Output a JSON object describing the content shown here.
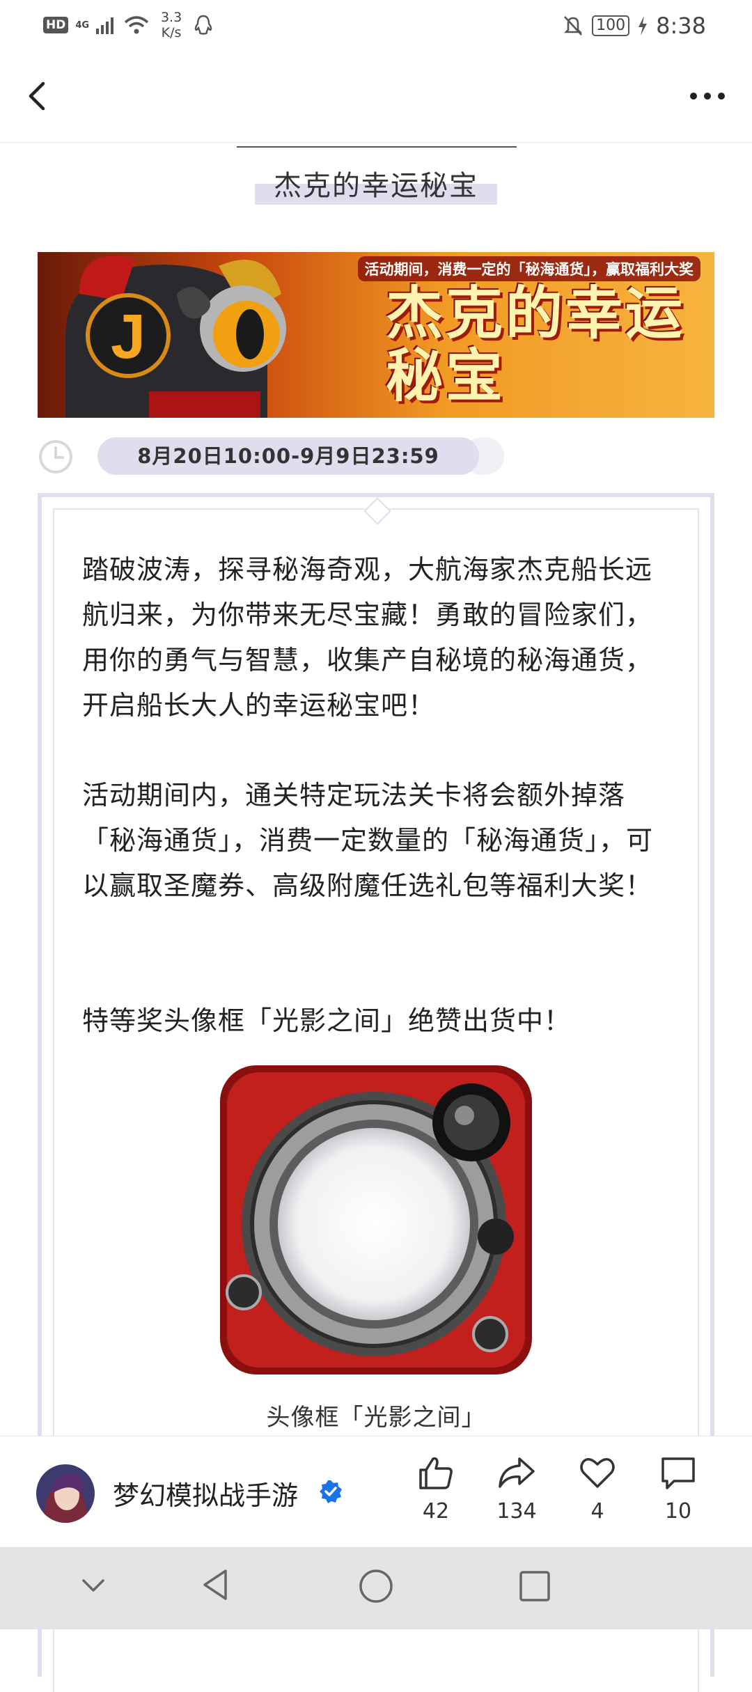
{
  "status_bar": {
    "hd": "HD",
    "network": "4G",
    "speed_value": "3.3",
    "speed_unit": "K/s",
    "battery": "100",
    "time": "8:38"
  },
  "article": {
    "title": "杰克的幸运秘宝",
    "banner": {
      "tagline": "活动期间，消费一定的「秘海通货」，赢取福利大奖",
      "title": "杰克的幸运秘宝"
    },
    "date_range": "8月20日10:00-9月9日23:59",
    "paragraphs": [
      "踏破波涛，探寻秘海奇观，大航海家杰克船长远航归来，为你带来无尽宝藏！勇敢的冒险家们，用你的勇气与智慧，收集产自秘境的秘海通货，开启船长大人的幸运秘宝吧！",
      "活动期间内，通关特定玩法关卡将会额外掉落「秘海通货」，消费一定数量的「秘海通货」，可以赢取圣魔券、高级附魔任选礼包等福利大奖！",
      "特等奖头像框「光影之间」绝赞出货中！"
    ],
    "image_caption": "头像框「光影之间」"
  },
  "bottom_bar": {
    "account_name": "梦幻模拟战手游",
    "likes": "42",
    "shares": "134",
    "favorites": "4",
    "comments": "10"
  },
  "colors": {
    "accent_lavender": "#e2dcef",
    "verified_blue": "#1a73e8"
  }
}
